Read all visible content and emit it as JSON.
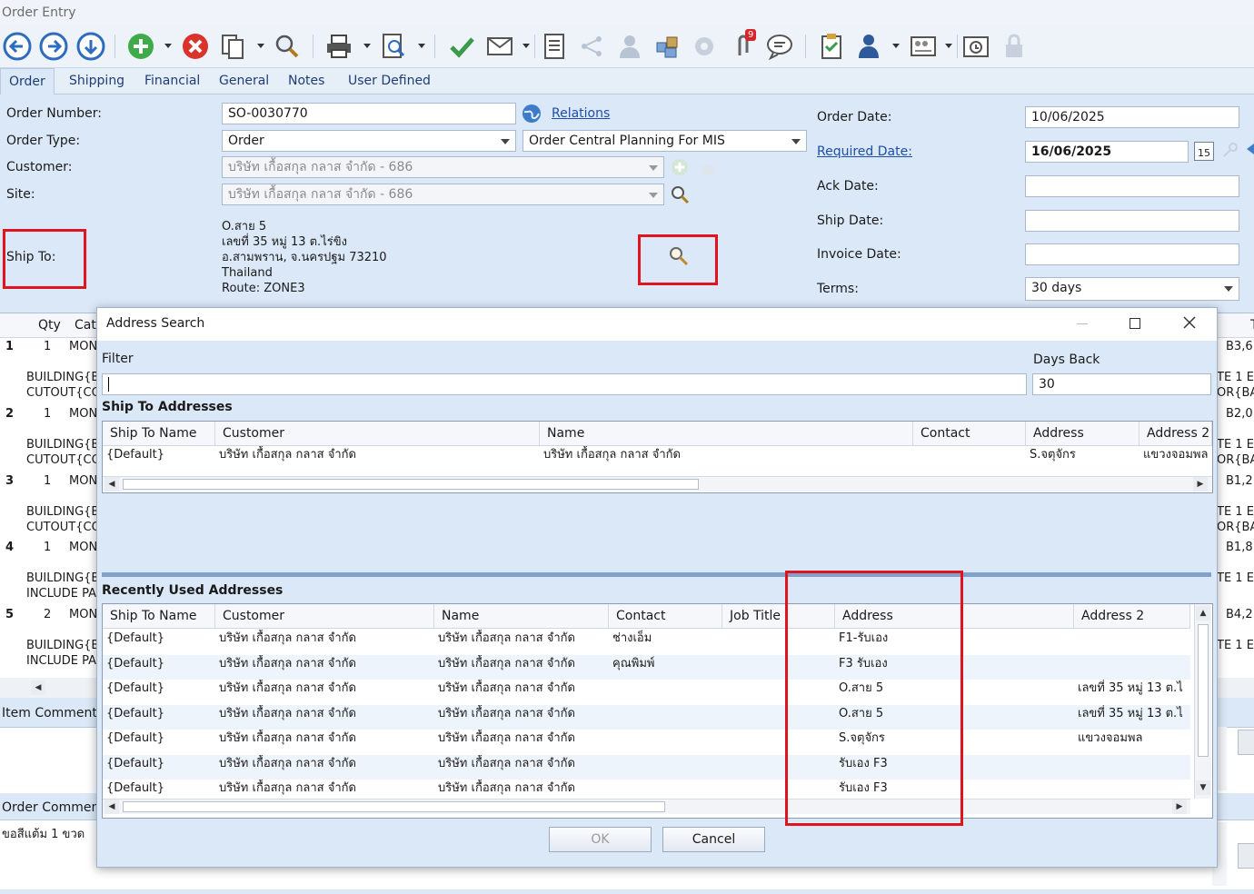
{
  "window": {
    "title": "Order Entry"
  },
  "tabs": [
    "Order",
    "Shipping",
    "Financial",
    "General",
    "Notes",
    "User Defined"
  ],
  "toolbar": {
    "badge_count": "9"
  },
  "form": {
    "order_number_label": "Order Number:",
    "order_number": "SO-0030770",
    "relations_link": "Relations",
    "order_type_label": "Order Type:",
    "order_type": "Order",
    "order_type_desc": "Order Central Planning For MIS",
    "customer_label": "Customer:",
    "customer": "บริษัท เกื้อสกุล กลาส  จำกัด - 686",
    "site_label": "Site:",
    "site": "บริษัท เกื้อสกุล กลาส  จำกัด - 686",
    "ship_to_label": "Ship To:",
    "ship_to_lines": [
      "O.สาย 5",
      "เลขที่ 35 หมู่ 13 ต.ไร่ขิง",
      "อ.สามพราน, จ.นครปฐม  73210",
      "Thailand",
      "Route: ZONE3"
    ],
    "order_date_label": "Order Date:",
    "order_date": "10/06/2025",
    "required_date_label": "Required Date:",
    "required_date": "16/06/2025",
    "calendar_day": "15",
    "ack_date_label": "Ack Date:",
    "ship_date_label": "Ship Date:",
    "invoice_date_label": "Invoice Date:",
    "terms_label": "Terms:",
    "terms": "30 days"
  },
  "line_grid": {
    "headers": {
      "qty": "Qty",
      "cat": "Cate"
    },
    "lines": [
      {
        "num": "1",
        "qty": "1",
        "cat": "MON",
        "desc": [
          "BUILDING{B",
          "CUTOUT{CO"
        ],
        "right_top": "B3,6",
        "right_desc": [
          "TE 1 E",
          "OR{BA"
        ]
      },
      {
        "num": "2",
        "qty": "1",
        "cat": "MON",
        "desc": [
          "BUILDING{B",
          "CUTOUT{CO"
        ],
        "right_top": "B2,0",
        "right_desc": [
          "TE 1 E",
          "OR{BA"
        ]
      },
      {
        "num": "3",
        "qty": "1",
        "cat": "MON",
        "desc": [
          "BUILDING{B",
          "CUTOUT{CO"
        ],
        "right_top": "B1,2",
        "right_desc": [
          "TE 1 E",
          "OR{BA"
        ]
      },
      {
        "num": "4",
        "qty": "1",
        "cat": "MON",
        "desc": [
          "BUILDING{B",
          "INCLUDE PA"
        ],
        "right_top": "B1,8",
        "right_desc": [
          "TE 1 E",
          ""
        ]
      },
      {
        "num": "5",
        "qty": "2",
        "cat": "MON",
        "desc": [
          "BUILDING{B",
          "INCLUDE PA"
        ],
        "right_top": "B4,2",
        "right_desc": [
          "TE 1 E",
          ""
        ]
      }
    ],
    "item_comment_label": "Item Comment:",
    "order_comment_label": "Order Comment:",
    "order_comment": "ขอสีแต้ม 1 ขวด"
  },
  "dialog": {
    "title": "Address Search",
    "filter_label": "Filter",
    "filter_value": "",
    "days_back_label": "Days Back",
    "days_back": "30",
    "ship_to_section": "Ship To Addresses",
    "ship_to_columns": [
      "Ship To Name",
      "Customer",
      "Name",
      "Contact",
      "Address",
      "Address 2"
    ],
    "ship_to_rows": [
      [
        "{Default}",
        "บริษัท เกื้อสกุล กลาส  จำกัด",
        "บริษัท เกื้อสกุล กลาส  จำกัด",
        "",
        "S.จตุจักร",
        "แขวงจอมพล"
      ]
    ],
    "recent_section": "Recently Used Addresses",
    "recent_columns": [
      "Ship To Name",
      "Customer",
      "Name",
      "Contact",
      "Job Title",
      "Address",
      "Address 2"
    ],
    "recent_rows": [
      [
        "{Default}",
        "บริษัท เกื้อสกุล กลาส  จำกัด",
        "บริษัท เกื้อสกุล กลาส  จำกัด",
        "ช่างเอ็ม",
        "",
        "F1-รับเอง",
        ""
      ],
      [
        "{Default}",
        "บริษัท เกื้อสกุล กลาส  จำกัด",
        "บริษัท เกื้อสกุล กลาส  จำกัด",
        "คุณพิมพ์",
        "",
        "F3 รับเอง",
        ""
      ],
      [
        "{Default}",
        "บริษัท เกื้อสกุล กลาส  จำกัด",
        "บริษัท เกื้อสกุล กลาส  จำกัด",
        "",
        "",
        "O.สาย 5",
        "เลขที่ 35 หมู่ 13 ต.ไ"
      ],
      [
        "{Default}",
        "บริษัท เกื้อสกุล กลาส  จำกัด",
        "บริษัท เกื้อสกุล กลาส  จำกัด",
        "",
        "",
        "O.สาย 5",
        "เลขที่ 35 หมู่ 13 ต.ไ"
      ],
      [
        "{Default}",
        "บริษัท เกื้อสกุล กลาส  จำกัด",
        "บริษัท เกื้อสกุล กลาส  จำกัด",
        "",
        "",
        "S.จตุจักร",
        "แขวงจอมพล"
      ],
      [
        "{Default}",
        "บริษัท เกื้อสกุล กลาส  จำกัด",
        "บริษัท เกื้อสกุล กลาส  จำกัด",
        "",
        "",
        "รับเอง F3",
        ""
      ],
      [
        "{Default}",
        "บริษัท เกื้อสกุล กลาส  จำกัด",
        "บริษัท เกื้อสกุล กลาส  จำกัด",
        "",
        "",
        "รับเอง F3",
        ""
      ]
    ],
    "ok_label": "OK",
    "cancel_label": "Cancel"
  },
  "colors": {
    "highlight": "#e0141e",
    "link": "#1e4fa8",
    "background": "#dbe8f7"
  }
}
